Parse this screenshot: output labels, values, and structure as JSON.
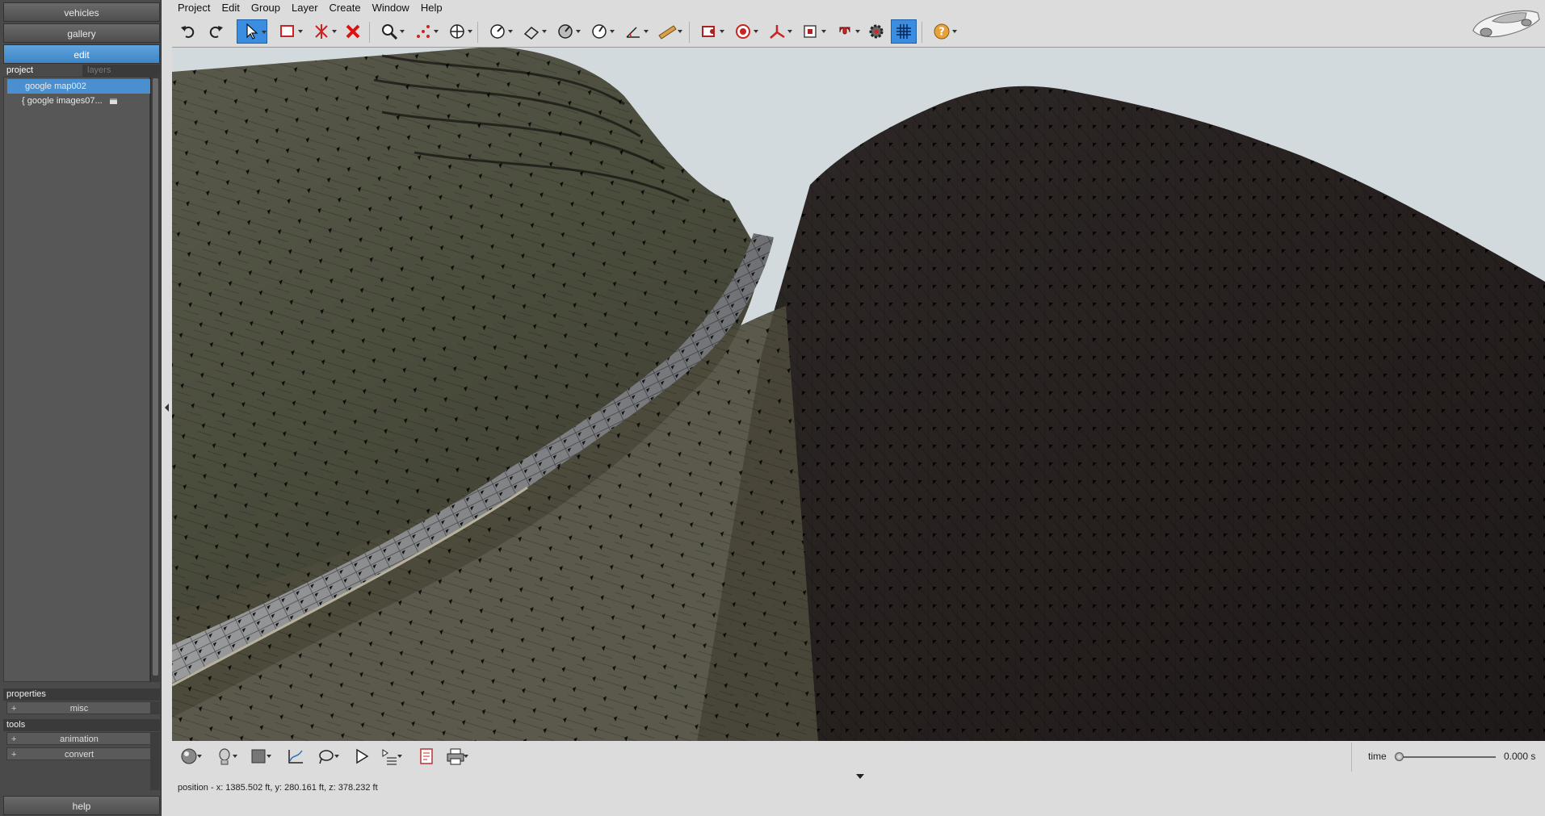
{
  "sidebar": {
    "vehicles_label": "vehicles",
    "gallery_label": "gallery",
    "edit_label": "edit",
    "tabs": {
      "project": "project",
      "layers": "layers"
    },
    "tree": [
      {
        "label": "google map002",
        "selected": true
      },
      {
        "label": "{ google images07..."
      }
    ],
    "properties_label": "properties",
    "misc_label": "misc",
    "tools_label": "tools",
    "animation_label": "animation",
    "convert_label": "convert",
    "help_label": "help",
    "accent_color": "#4a8fd0"
  },
  "menubar": [
    "Project",
    "Edit",
    "Group",
    "Layer",
    "Create",
    "Window",
    "Help"
  ],
  "toolbar": {
    "tools": [
      "undo-icon",
      "redo-icon",
      "select-arrow-icon",
      "rectangle-select-icon",
      "node-edit-icon",
      "delete-icon",
      "zoom-icon",
      "points-icon",
      "pan-icon",
      "gauge-icon",
      "eraser-icon",
      "angle-gauge-icon",
      "measure-icon",
      "dimension-icon",
      "ruler-icon",
      "marker-icon",
      "target-icon",
      "axes-icon",
      "camera-frame-icon",
      "magnet-icon",
      "gear-icon",
      "grid-icon",
      "help-icon"
    ],
    "active_tools": [
      "select-arrow-icon",
      "grid-icon"
    ]
  },
  "bottombar": {
    "tools": [
      "sphere-icon",
      "head-icon",
      "square-icon",
      "graph-icon",
      "lasso-icon",
      "play-icon",
      "sequence-icon",
      "report-icon",
      "print-icon"
    ]
  },
  "timeline": {
    "label": "time",
    "value": "0.000 s",
    "position": 0
  },
  "status": "position - x: 1385.502 ft, y: 280.161 ft, z: 378.232 ft",
  "scene_colors": {
    "sky": "#d3dade",
    "left_hill": "#4b4d3e",
    "right_hill": "#2a2422",
    "road": "#8a8c8f"
  }
}
